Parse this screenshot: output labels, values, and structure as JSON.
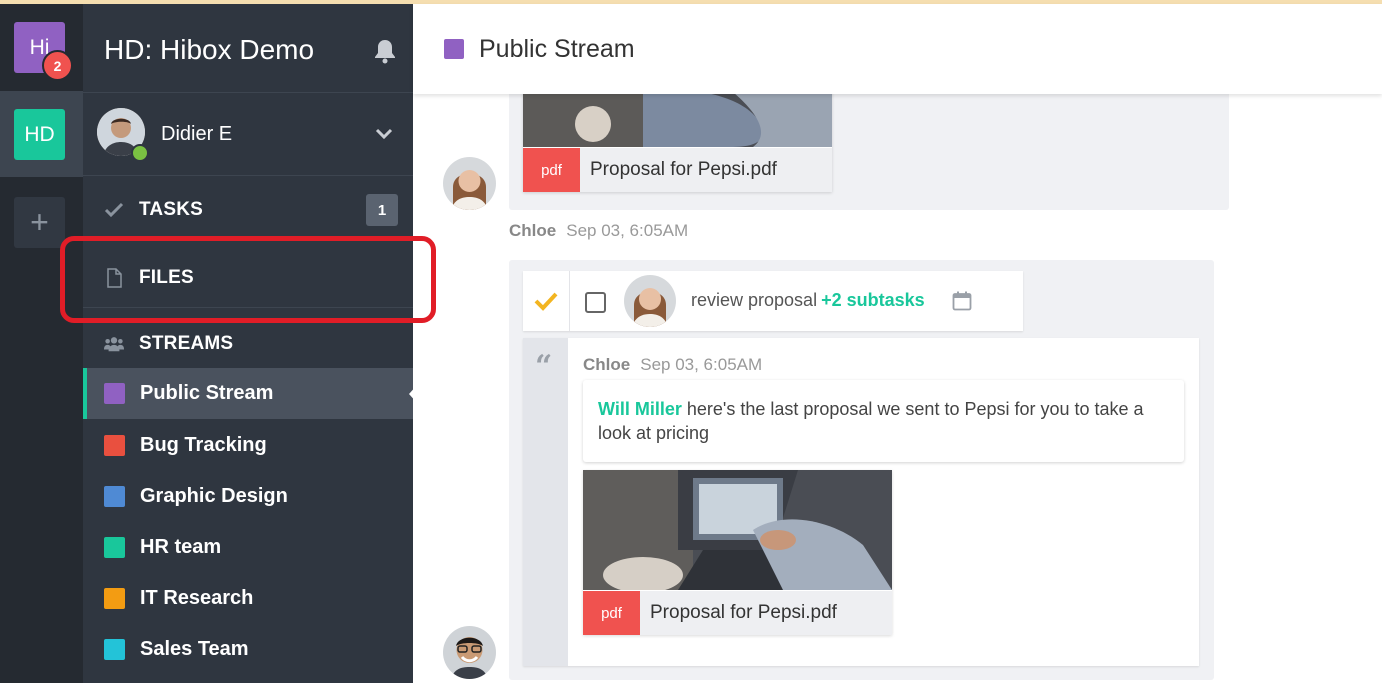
{
  "workspaces": [
    {
      "label": "Hi",
      "color": "#9061c2",
      "badge": "2"
    },
    {
      "label": "HD",
      "color": "#19c79b"
    }
  ],
  "add_workspace_label": "+",
  "sidebar": {
    "org_name": "HD: Hibox Demo",
    "user": {
      "name": "Didier E",
      "status": "online"
    },
    "nav": {
      "tasks": {
        "label": "TASKS",
        "count": "1"
      },
      "files": {
        "label": "FILES"
      },
      "streams": {
        "label": "STREAMS"
      }
    },
    "streams": [
      {
        "name": "Public Stream",
        "color": "#9061c2",
        "active": true
      },
      {
        "name": "Bug Tracking",
        "color": "#e9503f"
      },
      {
        "name": "Graphic Design",
        "color": "#4f8ad4"
      },
      {
        "name": "HR team",
        "color": "#19c79b"
      },
      {
        "name": "IT Research",
        "color": "#f39c12"
      },
      {
        "name": "Sales Team",
        "color": "#23c3d8"
      }
    ]
  },
  "main": {
    "title": "Public Stream",
    "title_color": "#9061c2",
    "messages": [
      {
        "file": {
          "type": "pdf",
          "name": "Proposal for Pepsi.pdf"
        }
      },
      {
        "author": "Chloe",
        "time": "Sep 03, 6:05AM",
        "task": {
          "title": "review proposal",
          "subtasks": "+2 subtasks"
        },
        "quote": {
          "author": "Chloe",
          "time": "Sep 03, 6:05AM",
          "mention": "Will Miller",
          "text": " here's the last proposal we sent to Pepsi for you to take a look at pricing",
          "file": {
            "type": "pdf",
            "name": "Proposal for Pepsi.pdf"
          }
        }
      }
    ]
  }
}
